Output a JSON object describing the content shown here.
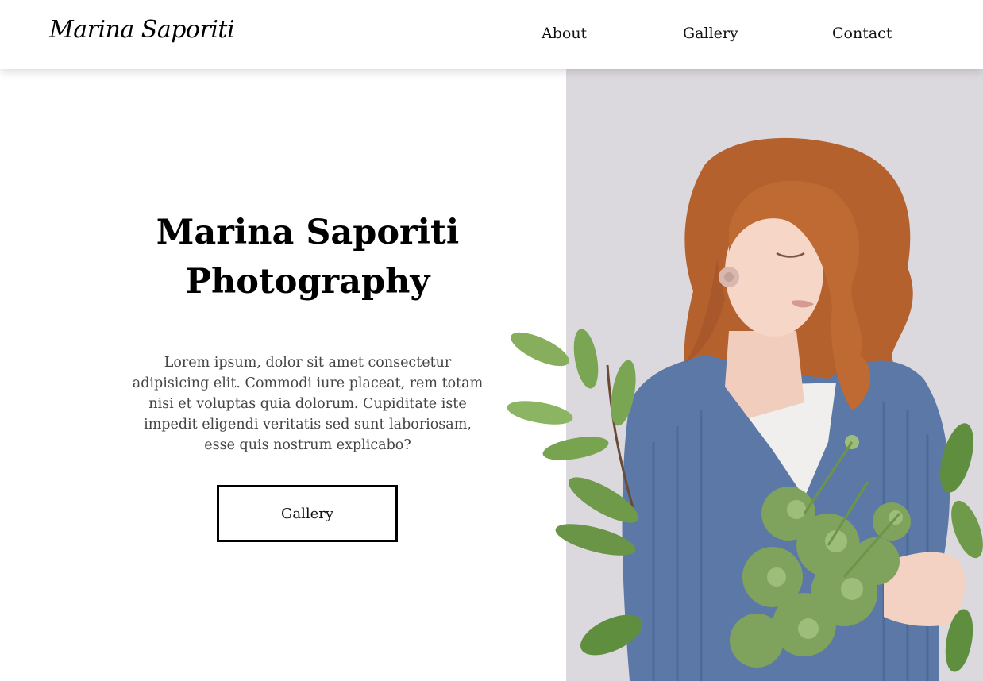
{
  "header": {
    "logo": "Marina Saporiti",
    "nav": {
      "about": "About",
      "gallery": "Gallery",
      "contact": "Contact"
    }
  },
  "hero": {
    "title_line1": "Marina Saporiti",
    "title_line2": "Photography",
    "description": "Lorem ipsum, dolor sit amet consectetur adipisicing elit. Commodi iure placeat, rem totam nisi et voluptas quia dolorum. Cupiditate iste impedit eligendi veritatis sed sunt laboriosam, esse quis nostrum explicabo?",
    "button_label": "Gallery"
  },
  "colors": {
    "panel_bg": "#dcd9de",
    "hair": "#b8632e",
    "sweater": "#5b78a6",
    "leaf": "#6f9a4a",
    "skin": "#f3d3c4"
  }
}
